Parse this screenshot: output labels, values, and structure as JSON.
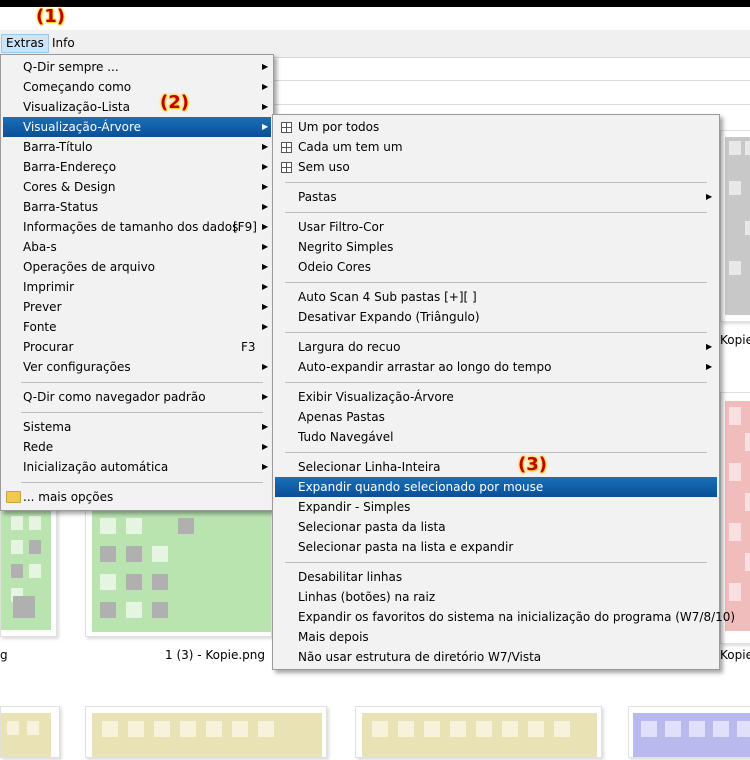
{
  "menubar": {
    "extras": "Extras",
    "info": "Info"
  },
  "annotations": {
    "a1": "(1)",
    "a2": "(2)",
    "a3": "(3)"
  },
  "background": {
    "file1": "1 (3) - Kopie.png",
    "kopie_right_top": "Kopie",
    "kopie_right_bottom": "Kopie",
    "left_fragment": "g"
  },
  "extras_menu": {
    "items": [
      {
        "label": "Q-Dir sempre ...",
        "submenu": true
      },
      {
        "label": "Começando como",
        "submenu": true
      },
      {
        "label": "Visualização-Lista",
        "submenu": true
      },
      {
        "label": "Visualização-Árvore",
        "submenu": true,
        "highlighted": true
      },
      {
        "label": "Barra-Título",
        "submenu": true
      },
      {
        "label": "Barra-Endereço",
        "submenu": true
      },
      {
        "label": "Cores & Design",
        "submenu": true
      },
      {
        "label": "Barra-Status",
        "submenu": true
      },
      {
        "label": "Informações de tamanho dos dados",
        "shortcut": "[F9]",
        "submenu": true
      },
      {
        "label": "Aba-s",
        "submenu": true
      },
      {
        "label": "Operações de arquivo",
        "submenu": true
      },
      {
        "label": "Imprimir",
        "submenu": true
      },
      {
        "label": "Prever",
        "submenu": true
      },
      {
        "label": "Fonte",
        "submenu": true
      },
      {
        "label": "Procurar",
        "shortcut": "F3",
        "submenu": false
      },
      {
        "label": "Ver configurações",
        "submenu": true
      },
      {
        "label": "Q-Dir como navegador padrão",
        "submenu": true
      },
      {
        "label": "Sistema",
        "submenu": true
      },
      {
        "label": "Rede",
        "submenu": true
      },
      {
        "label": "Inicialização automática",
        "submenu": true
      },
      {
        "label": "... mais opções",
        "submenu": false
      }
    ]
  },
  "tree_menu": {
    "items": [
      {
        "label": "Um por todos"
      },
      {
        "label": "Cada um tem um"
      },
      {
        "label": "Sem uso"
      },
      {
        "label": "Pastas"
      },
      {
        "label": "Usar Filtro-Cor"
      },
      {
        "label": "Negrito Simples"
      },
      {
        "label": "Odeio Cores"
      },
      {
        "label": "Auto Scan 4 Sub pastas [+][ ]"
      },
      {
        "label": "Desativar Expando (Triângulo)"
      },
      {
        "label": "Largura do recuo"
      },
      {
        "label": "Auto-expandir arrastar ao longo do tempo"
      },
      {
        "label": "Exibir Visualização-Árvore"
      },
      {
        "label": "Apenas Pastas"
      },
      {
        "label": "Tudo Navegável"
      },
      {
        "label": "Selecionar Linha-Inteira"
      },
      {
        "label": "Expandir quando selecionado por mouse",
        "highlighted": true
      },
      {
        "label": "Expandir - Simples"
      },
      {
        "label": "Selecionar pasta da lista"
      },
      {
        "label": "Selecionar pasta na lista e expandir"
      },
      {
        "label": "Desabilitar linhas"
      },
      {
        "label": "Linhas (botões) na raiz"
      },
      {
        "label": "Expandir os favoritos do sistema na inicialização do programa (W7/8/10)"
      },
      {
        "label": "Mais depois"
      },
      {
        "label": "Não usar estrutura de diretório W7/Vista"
      }
    ]
  }
}
